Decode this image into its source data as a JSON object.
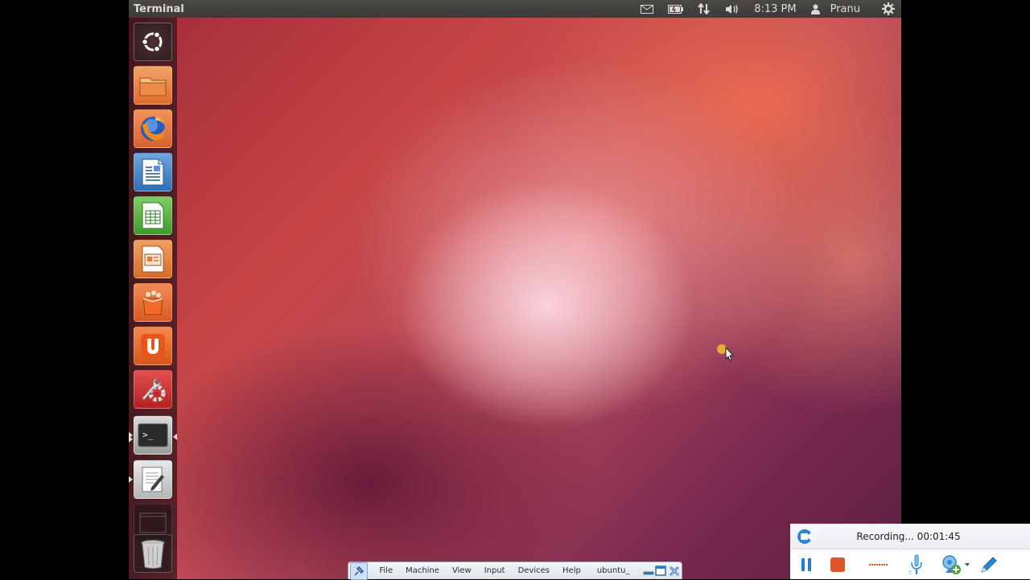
{
  "topbar": {
    "app_title": "Terminal",
    "tray": {
      "mail_icon": "mail-icon",
      "battery_icon": "battery-icon",
      "network_icon": "network-updown-icon",
      "volume_icon": "volume-icon",
      "clock": "8:13 PM",
      "user_icon": "user-icon",
      "user": "Pranu",
      "settings_icon": "gear-icon"
    }
  },
  "launcher": {
    "items": [
      {
        "name": "dash-home",
        "icon": "ubuntu-logo-icon"
      },
      {
        "name": "files",
        "icon": "folder-icon"
      },
      {
        "name": "firefox",
        "icon": "firefox-icon"
      },
      {
        "name": "libreoffice-writer",
        "icon": "writer-icon"
      },
      {
        "name": "libreoffice-calc",
        "icon": "calc-icon"
      },
      {
        "name": "libreoffice-impress",
        "icon": "impress-icon"
      },
      {
        "name": "software-center",
        "icon": "shopping-bag-icon"
      },
      {
        "name": "ubuntu-one",
        "icon": "ubuntu-one-icon"
      },
      {
        "name": "system-settings",
        "icon": "settings-wrench-icon"
      },
      {
        "name": "terminal",
        "icon": "terminal-icon"
      },
      {
        "name": "text-editor",
        "icon": "text-editor-icon"
      },
      {
        "name": "workspace-switcher",
        "icon": "workspace-icon"
      },
      {
        "name": "trash",
        "icon": "trash-icon"
      }
    ],
    "terminal_glyph": ">_"
  },
  "vbox_menubar": {
    "menus": [
      "File",
      "Machine",
      "View",
      "Input",
      "Devices",
      "Help"
    ],
    "machine_name": "ubuntu_"
  },
  "recorder": {
    "status": "Recording... 00:01:45",
    "colors": {
      "pause": "#1f7fd0",
      "stop": "#e0552b"
    }
  },
  "colors": {
    "topbar_bg": "#3c3b37",
    "launcher_orange": "#e46d2e",
    "accent_green": "#4ca23a"
  }
}
